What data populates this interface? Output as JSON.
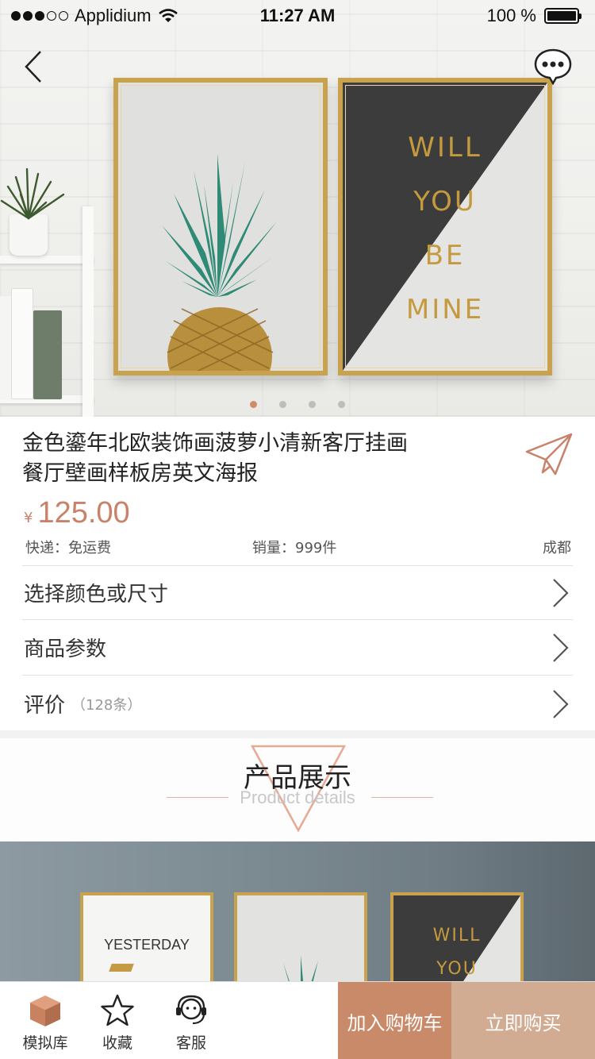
{
  "status_bar": {
    "carrier": "Applidium",
    "time": "11:27 AM",
    "battery": "100 %"
  },
  "hero": {
    "poster_left_subject": "pineapple",
    "poster_right_lines": [
      "WILL",
      "YOU",
      "BE",
      "MINE"
    ],
    "carousel_count": 4,
    "carousel_active": 0
  },
  "product": {
    "title_line1": "金色鎏年北欧装饰画菠萝小清新客厅挂画",
    "title_line2": "餐厅壁画样板房英文海报",
    "currency": "¥",
    "price": "125.00",
    "shipping": "快递：免运费",
    "sales": "销量：999件",
    "location": "成都"
  },
  "options": [
    {
      "label": "选择颜色或尺寸",
      "sub": ""
    },
    {
      "label": "商品参数",
      "sub": ""
    },
    {
      "label": "评价",
      "sub": "（128条）"
    }
  ],
  "details_header": {
    "title": "产品展示",
    "subtitle": "Product details"
  },
  "detail_image": {
    "poster_texts": [
      "YESTERDAY",
      "WILL",
      "YOU"
    ]
  },
  "bottom_bar": {
    "tabs": [
      {
        "label": "模拟库",
        "icon": "box-icon"
      },
      {
        "label": "收藏",
        "icon": "star-icon"
      },
      {
        "label": "客服",
        "icon": "headset-icon"
      }
    ],
    "add_to_cart": "加入购物车",
    "buy_now": "立即购买"
  },
  "colors": {
    "accent": "#c98a69",
    "accent_light": "#d1ab92",
    "gold": "#c9a24d",
    "pineapple_leaf": "#2f8a76"
  }
}
